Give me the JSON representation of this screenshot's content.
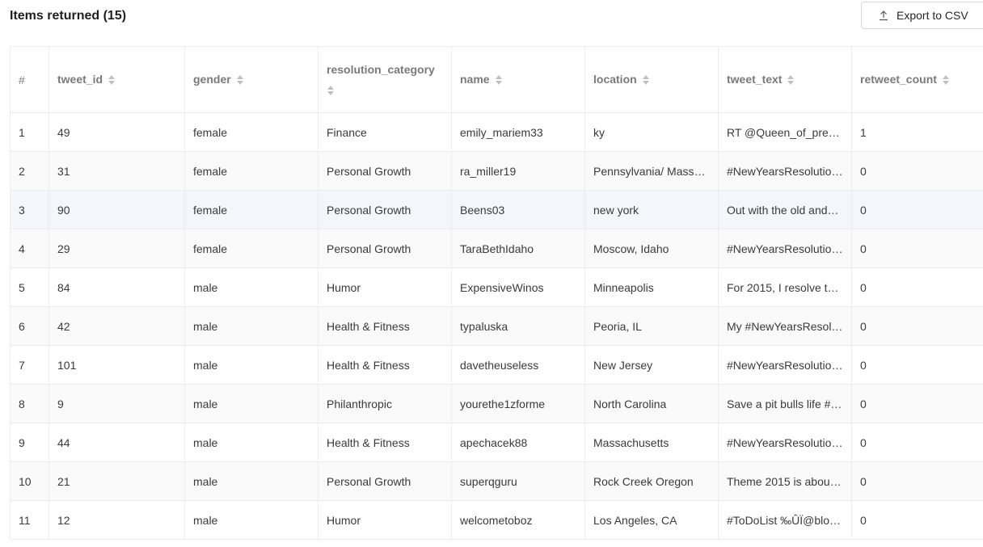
{
  "header": {
    "items_title": "Items returned (15)",
    "export_label": "Export to CSV",
    "export_icon": "upload-icon"
  },
  "table": {
    "columns": [
      "#",
      "tweet_id",
      "gender",
      "resolution_category",
      "name",
      "location",
      "tweet_text",
      "retweet_count"
    ],
    "rows": [
      [
        "1",
        "49",
        "female",
        "Finance",
        "emily_mariem33",
        "ky",
        "RT @Queen_of_prep…",
        "1"
      ],
      [
        "2",
        "31",
        "female",
        "Personal Growth",
        "ra_miller19",
        "Pennsylvania/ Mass…",
        "#NewYearsResolutio…",
        "0"
      ],
      [
        "3",
        "90",
        "female",
        "Personal Growth",
        "Beens03",
        "new york",
        "Out with the old and…",
        "0"
      ],
      [
        "4",
        "29",
        "female",
        "Personal Growth",
        "TaraBethIdaho",
        "Moscow, Idaho",
        "#NewYearsResolutio…",
        "0"
      ],
      [
        "5",
        "84",
        "male",
        "Humor",
        "ExpensiveWinos",
        "Minneapolis",
        "For 2015, I resolve t…",
        "0"
      ],
      [
        "6",
        "42",
        "male",
        "Health & Fitness",
        "typaluska",
        "Peoria, IL",
        "My #NewYearsResol…",
        "0"
      ],
      [
        "7",
        "101",
        "male",
        "Health & Fitness",
        "davetheuseless",
        "New Jersey",
        "#NewYearsResolutio…",
        "0"
      ],
      [
        "8",
        "9",
        "male",
        "Philanthropic",
        "yourethe1zforme",
        "North Carolina",
        "Save a pit bulls life #…",
        "0"
      ],
      [
        "9",
        "44",
        "male",
        "Health & Fitness",
        "apechacek88",
        "Massachusetts",
        "#NewYearsResolutio…",
        "0"
      ],
      [
        "10",
        "21",
        "male",
        "Personal Growth",
        "superqguru",
        "Rock Creek Oregon",
        "Theme 2015 is abou…",
        "0"
      ],
      [
        "11",
        "12",
        "male",
        "Humor",
        "welcometoboz",
        "Los Angeles, CA",
        "#ToDoList ‰ÛÏ@blo…",
        "0"
      ]
    ]
  }
}
